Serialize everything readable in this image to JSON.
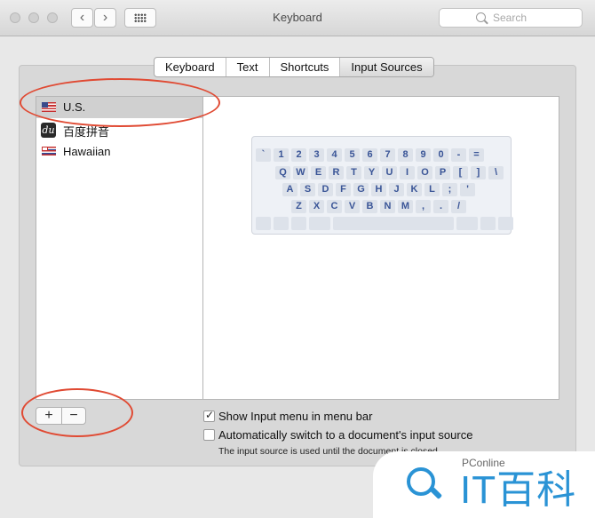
{
  "window": {
    "title": "Keyboard"
  },
  "toolbar": {
    "back_glyph": "‹",
    "forward_glyph": "›",
    "search_placeholder": "Search"
  },
  "tabs": [
    {
      "label": "Keyboard",
      "active": false
    },
    {
      "label": "Text",
      "active": false
    },
    {
      "label": "Shortcuts",
      "active": false
    },
    {
      "label": "Input Sources",
      "active": true
    }
  ],
  "sources": [
    {
      "label": "U.S.",
      "icon": "us-flag-icon",
      "selected": true
    },
    {
      "label": "百度拼音",
      "icon": "baidu-du-icon",
      "selected": false
    },
    {
      "label": "Hawaiian",
      "icon": "hawaii-flag-icon",
      "selected": false
    }
  ],
  "keyboard": {
    "rows": [
      [
        "`",
        "1",
        "2",
        "3",
        "4",
        "5",
        "6",
        "7",
        "8",
        "9",
        "0",
        "-",
        "="
      ],
      [
        "Q",
        "W",
        "E",
        "R",
        "T",
        "Y",
        "U",
        "I",
        "O",
        "P",
        "[",
        "]",
        "\\"
      ],
      [
        "A",
        "S",
        "D",
        "F",
        "G",
        "H",
        "J",
        "K",
        "L",
        ";",
        "'"
      ],
      [
        "Z",
        "X",
        "C",
        "V",
        "B",
        "N",
        "M",
        ",",
        ".",
        "/"
      ]
    ]
  },
  "list_buttons": {
    "add": "+",
    "remove": "−"
  },
  "options": {
    "show_menu": {
      "label": "Show Input menu in menu bar",
      "checked": true
    },
    "auto_switch": {
      "label": "Automatically switch to a document's input source",
      "checked": false
    },
    "note": "The input source is used until the document is closed"
  },
  "annotation_color": "#e04a33",
  "watermark": {
    "site": "PConline",
    "brand": "IT百科",
    "color": "#2a93d5"
  }
}
